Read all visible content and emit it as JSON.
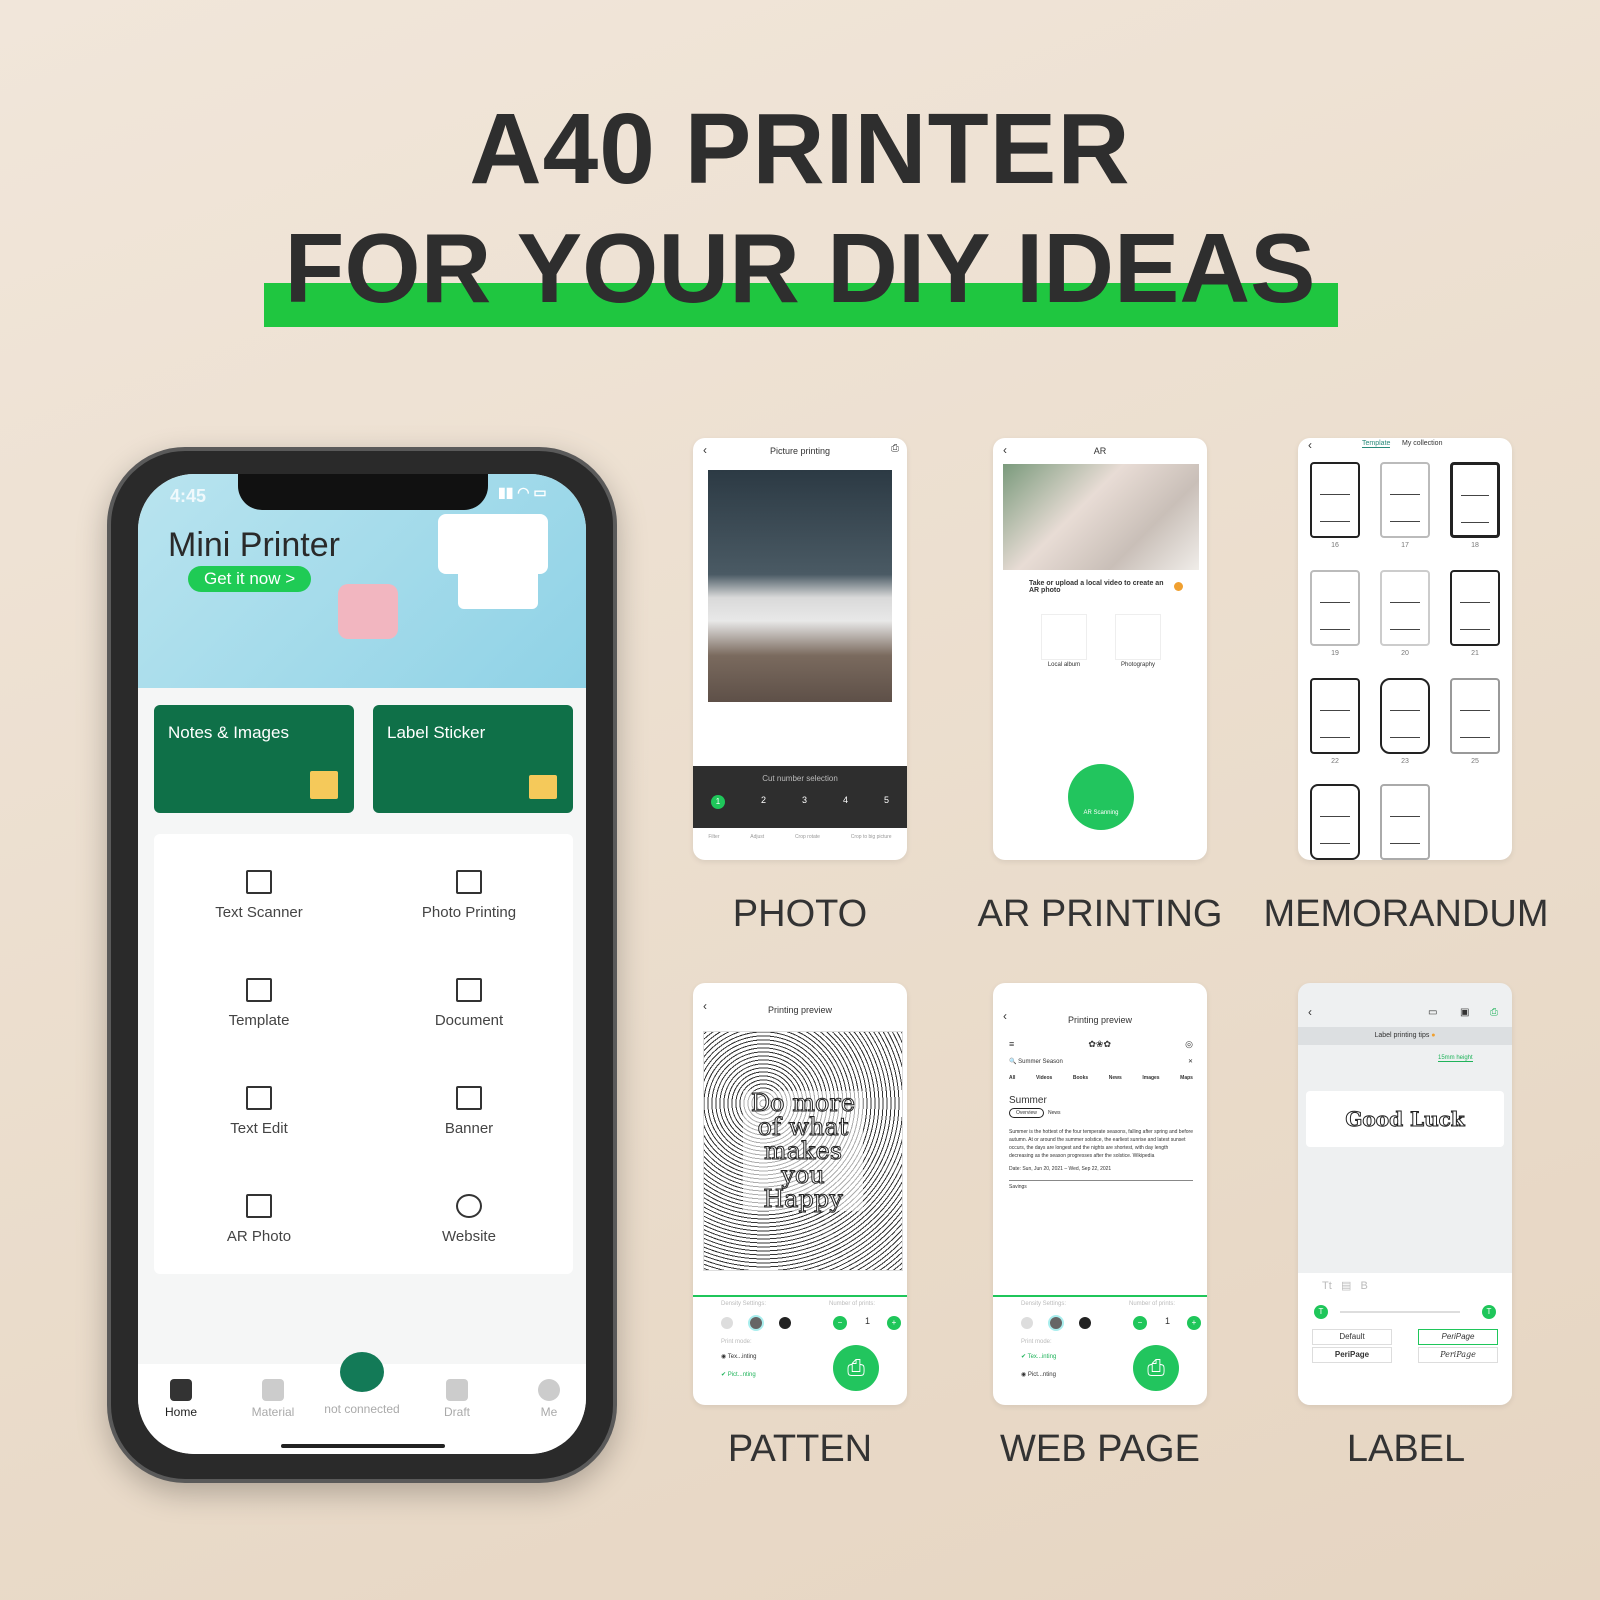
{
  "headline": {
    "line1": "A40 PRINTER",
    "line2": "FOR YOUR DIY IDEAS",
    "highlight_color": "#1fc640"
  },
  "phone": {
    "status_time": "4:45",
    "banner": {
      "title": "Mini Printer",
      "cta": "Get it now >"
    },
    "cards": [
      {
        "label": "Notes & Images",
        "icon": "note-icon"
      },
      {
        "label": "Label Sticker",
        "icon": "label-icon"
      }
    ],
    "grid": [
      {
        "label": "Text Scanner",
        "icon": "scan-icon"
      },
      {
        "label": "Photo Printing",
        "icon": "image-icon"
      },
      {
        "label": "Template",
        "icon": "template-icon"
      },
      {
        "label": "Document",
        "icon": "folder-icon"
      },
      {
        "label": "Text Edit",
        "icon": "text-edit-icon"
      },
      {
        "label": "Banner",
        "icon": "banner-icon"
      },
      {
        "label": "AR Photo",
        "icon": "ar-camera-icon"
      },
      {
        "label": "Website",
        "icon": "globe-icon"
      }
    ],
    "nav": [
      {
        "label": "Home",
        "active": true
      },
      {
        "label": "Material"
      },
      {
        "label": "not connected"
      },
      {
        "label": "Draft"
      },
      {
        "label": "Me"
      }
    ],
    "accent": "#0f7048"
  },
  "screens": {
    "photo": {
      "caption": "PHOTO",
      "title": "Picture printing",
      "cut_label": "Cut number selection",
      "cuts": [
        "1",
        "2",
        "3",
        "4",
        "5"
      ],
      "tools": [
        "Filter",
        "Adjust",
        "Crop rotate",
        "Crop to big picture"
      ]
    },
    "ar": {
      "caption": "AR PRINTING",
      "title": "AR",
      "prompt": "Take or upload a local video to create an AR photo",
      "options": [
        "Local album",
        "Photography"
      ],
      "scan": "AR Scanning"
    },
    "memo": {
      "caption": "MEMORANDUM",
      "tabs": [
        "Template",
        "My collection"
      ],
      "numbers": [
        "16",
        "17",
        "18",
        "19",
        "20",
        "21",
        "22",
        "23",
        "25"
      ]
    },
    "patten": {
      "caption": "PATTEN",
      "title": "Printing preview",
      "art_text": "Do more of what makes you Happy",
      "density": "Density Settings:",
      "prints_label": "Number of prints:",
      "prints": "1",
      "mode_label": "Print mode:",
      "modes": [
        "Tex...inting",
        "Pict...nting"
      ]
    },
    "web": {
      "caption": "WEB PAGE",
      "title": "Printing preview",
      "search": "Summer Season",
      "tabs": [
        "All",
        "Videos",
        "Books",
        "News",
        "Images",
        "Maps"
      ],
      "heading": "Summer",
      "chips": [
        "Overview",
        "News"
      ],
      "body": "Summer is the hottest of the four temperate seasons, falling after spring and before autumn. At or around the summer solstice, the earliest sunrise and latest sunset occurs, the days are longest and the nights are shortest, with day length decreasing as the season progresses after the solstice. Wikipedia",
      "date": "Date: Sun, Jun 20, 2021 – Wed, Sep 22, 2021",
      "savings": "Savings",
      "density": "Density Settings:",
      "prints_label": "Number of prints:",
      "prints": "1",
      "mode_label": "Print mode:",
      "modes": [
        "Tex...inting",
        "Pict...nting"
      ]
    },
    "label": {
      "caption": "LABEL",
      "tips": "Label printing tips",
      "height": "15mm height",
      "text": "Good Luck",
      "fonts": [
        "Default",
        "PeriPage",
        "PeriPage",
        "PeriPage"
      ]
    }
  }
}
